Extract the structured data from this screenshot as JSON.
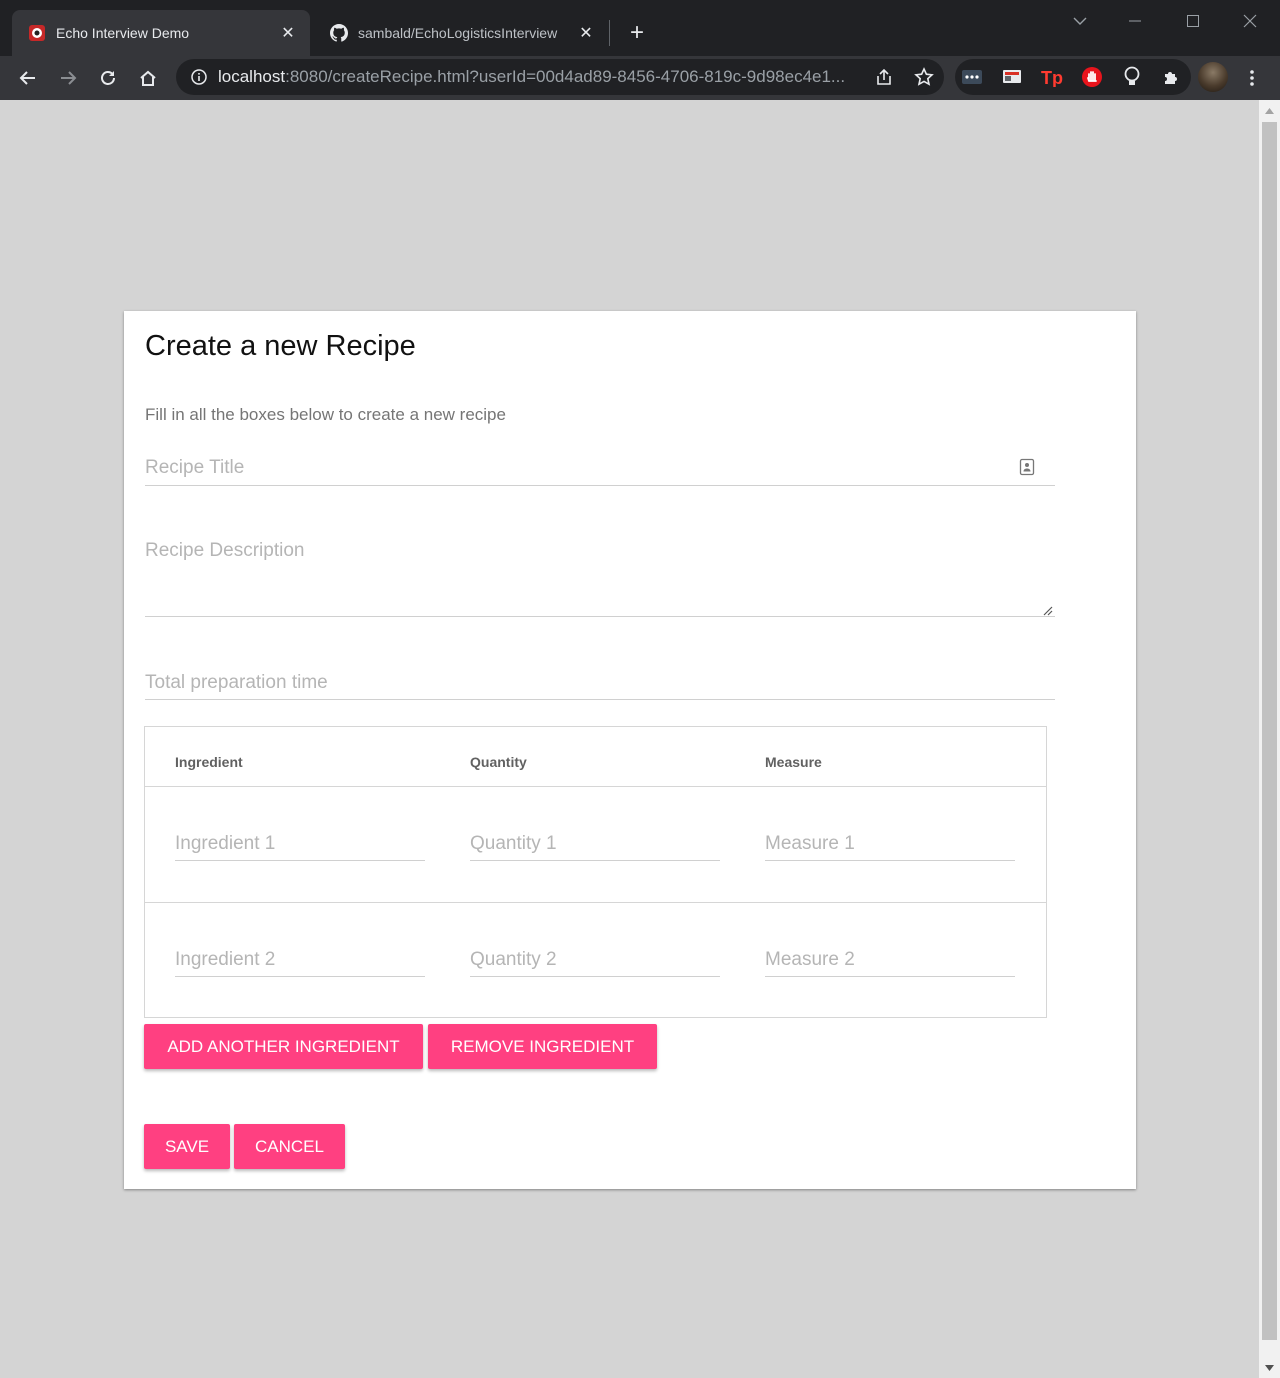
{
  "browser": {
    "tabs": [
      {
        "title": "Echo Interview Demo",
        "active": true,
        "favicon": "red-echo-icon"
      },
      {
        "title": "sambald/EchoLogisticsInterview",
        "active": false,
        "favicon": "github-icon"
      }
    ],
    "url_host": "localhost",
    "url_rest": ":8080/createRecipe.html?userId=00d4ad89-8456-4706-819c-9d98ec4e1...",
    "extensions": [
      "dots-extension-icon",
      "cast-extension-icon",
      "tp-extension-icon",
      "hand-stop-extension-icon",
      "lightbulb-extension-icon",
      "puzzle-extensions-icon"
    ],
    "colors": {
      "tabstrip": "#202124",
      "toolbar": "#35363a",
      "tp": "#ff3b30",
      "hand": "#e8141c"
    }
  },
  "form": {
    "title": "Create a new Recipe",
    "subtitle": "Fill in all the boxes below to create a new recipe",
    "recipe_title_placeholder": "Recipe Title",
    "recipe_description_placeholder": "Recipe Description",
    "prep_time_placeholder": "Total preparation time",
    "table": {
      "headers": [
        "Ingredient",
        "Quantity",
        "Measure"
      ],
      "rows": [
        {
          "ingredient": "Ingredient 1",
          "quantity": "Quantity 1",
          "measure": "Measure 1"
        },
        {
          "ingredient": "Ingredient 2",
          "quantity": "Quantity 2",
          "measure": "Measure 2"
        }
      ]
    },
    "buttons": {
      "add_ingredient": "ADD ANOTHER INGREDIENT",
      "remove_ingredient": "REMOVE INGREDIENT",
      "save": "SAVE",
      "cancel": "CANCEL"
    },
    "accent_color": "#ff4081"
  }
}
